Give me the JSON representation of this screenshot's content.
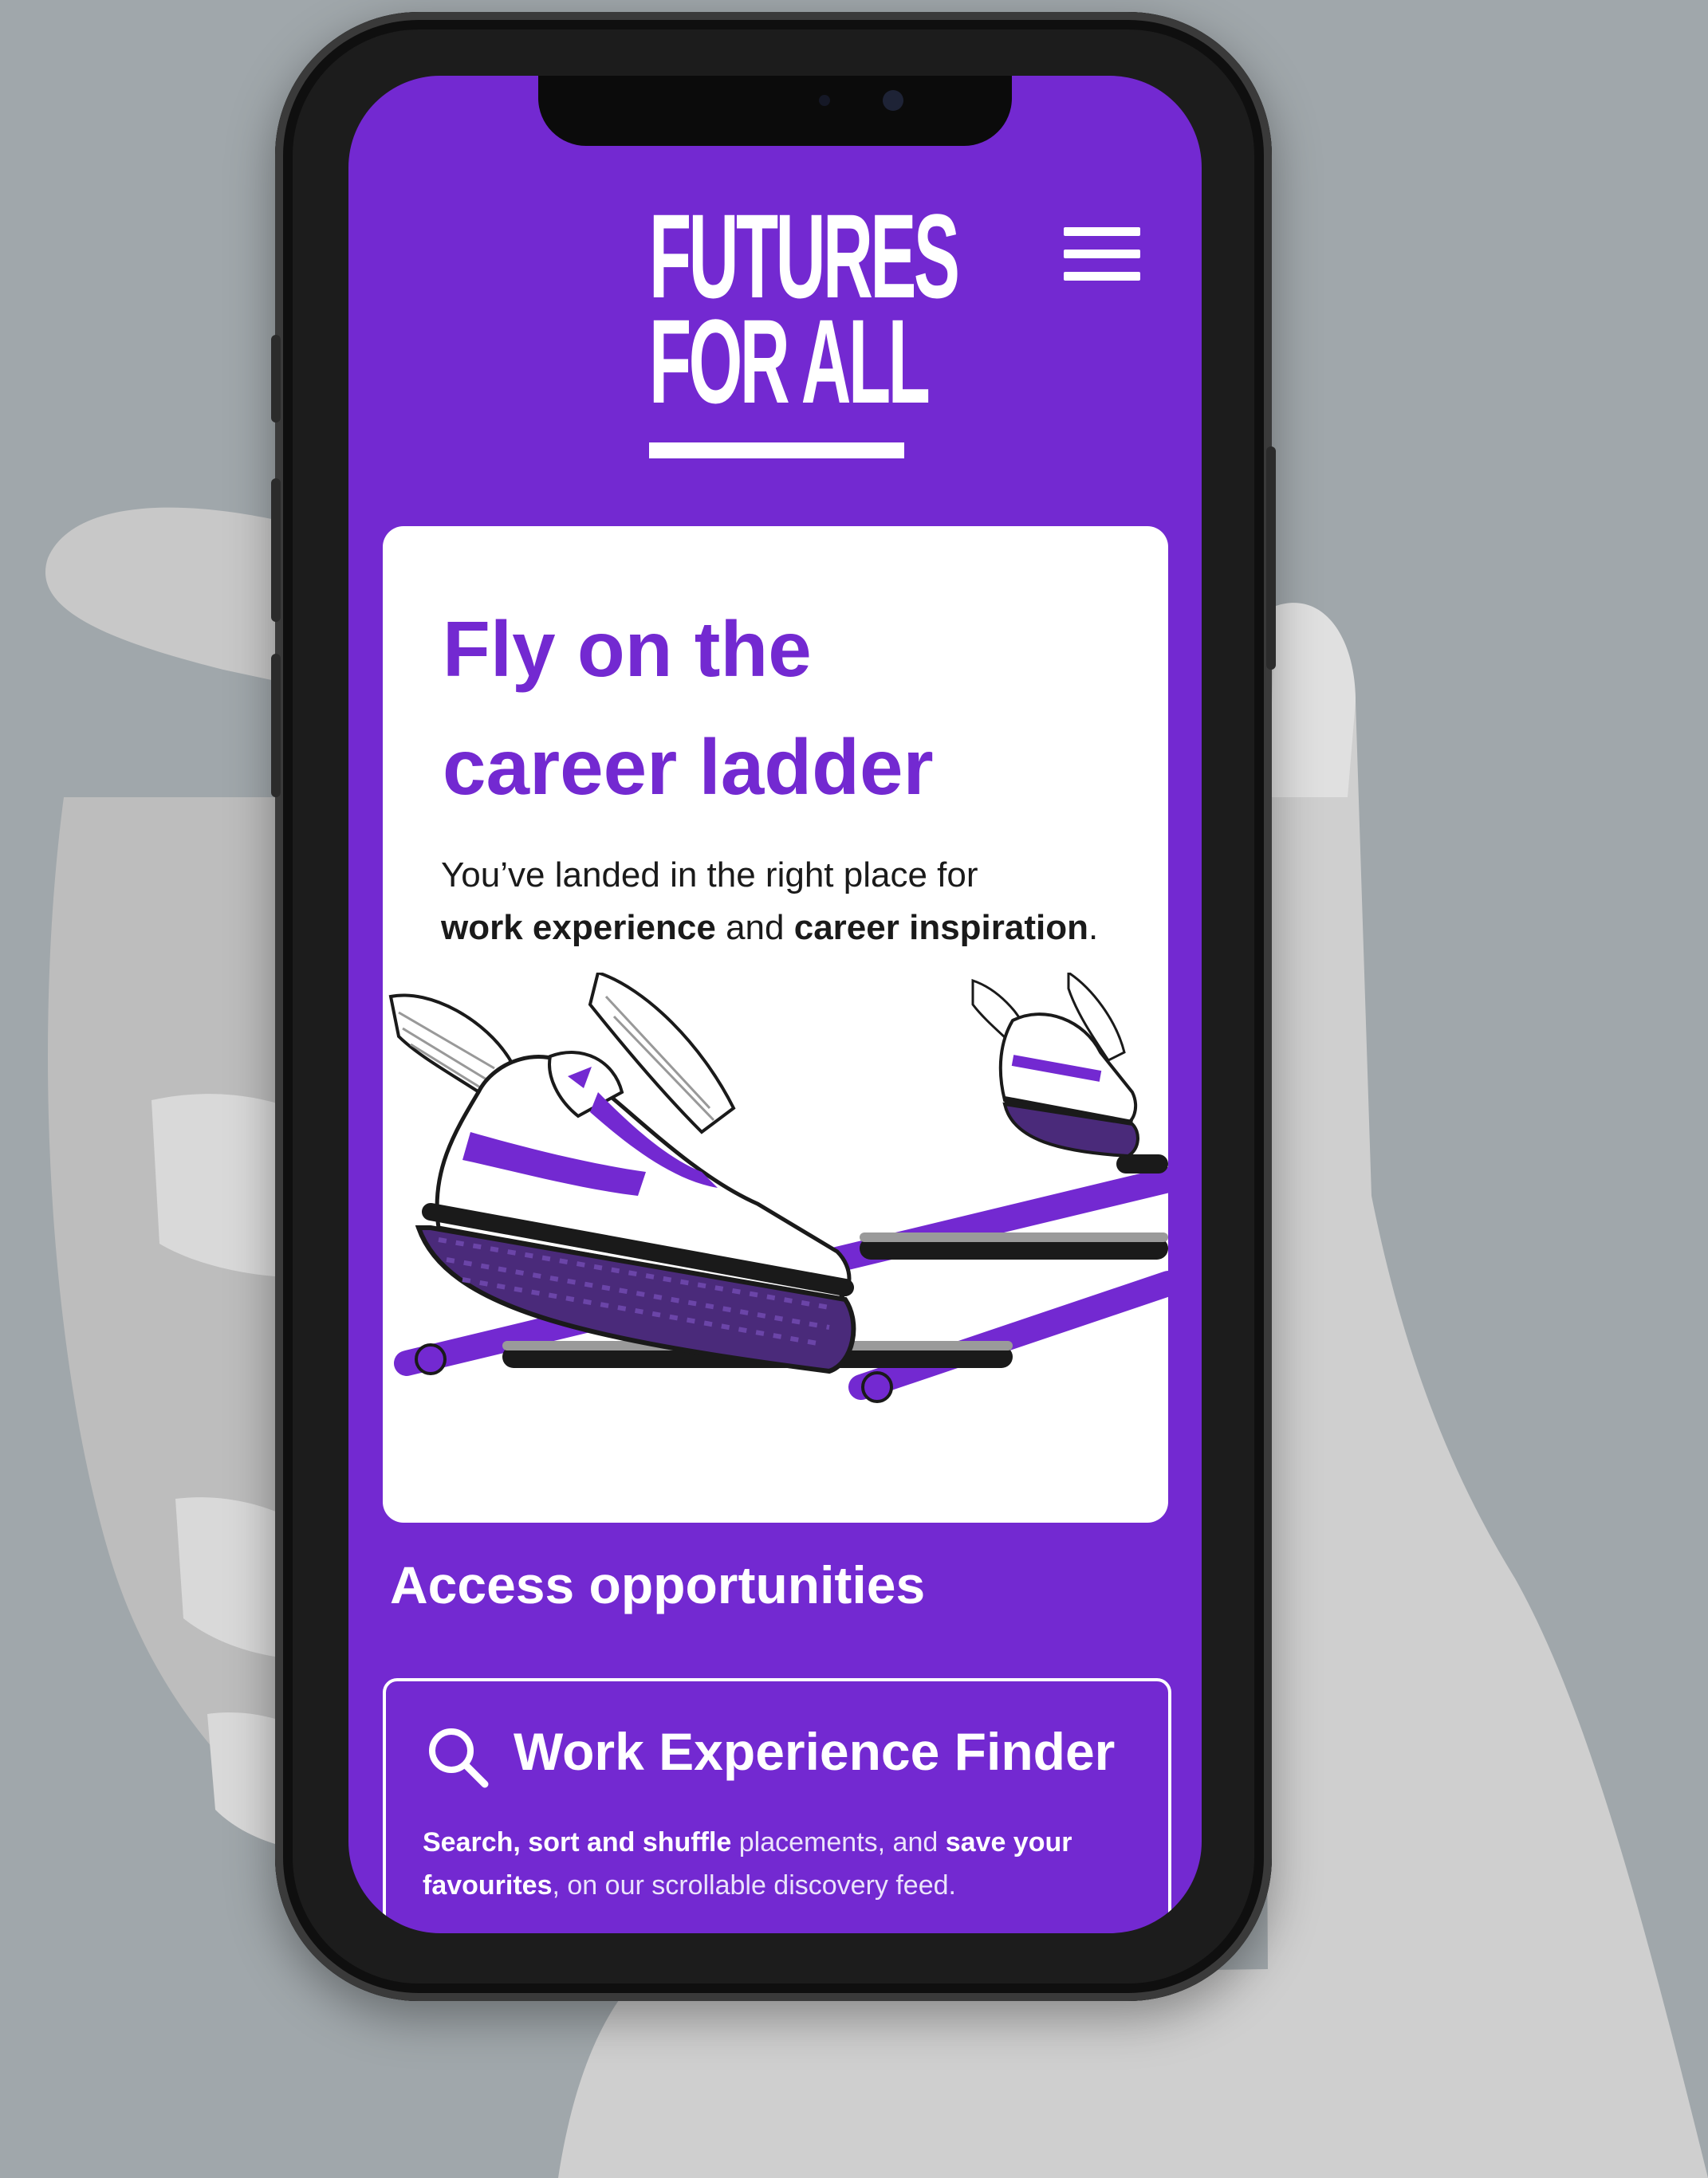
{
  "logo": {
    "line1": "FUTURES",
    "line2": "FOR ALL"
  },
  "header": {
    "menu_icon": "hamburger-menu-icon"
  },
  "hero": {
    "title_line1": "Fly on the",
    "title_line2": "career ladder",
    "text_part1": "You’ve landed in the right place for",
    "text_bold1": "work experience",
    "text_part2": " and ",
    "text_bold2": "career inspiration",
    "text_part3": "."
  },
  "access": {
    "title": "Access opportunities",
    "finder": {
      "icon": "search-icon",
      "title": "Work Experience Finder",
      "desc_bold1": "Search, sort and shuffle",
      "desc_part1": " placements, and ",
      "desc_bold2": "save your favourites",
      "desc_part2": ", on our scrollable discovery feed."
    }
  },
  "colors": {
    "brand_purple": "#7329d1",
    "card_white": "#ffffff",
    "background_grey": "#a0a7ab"
  }
}
